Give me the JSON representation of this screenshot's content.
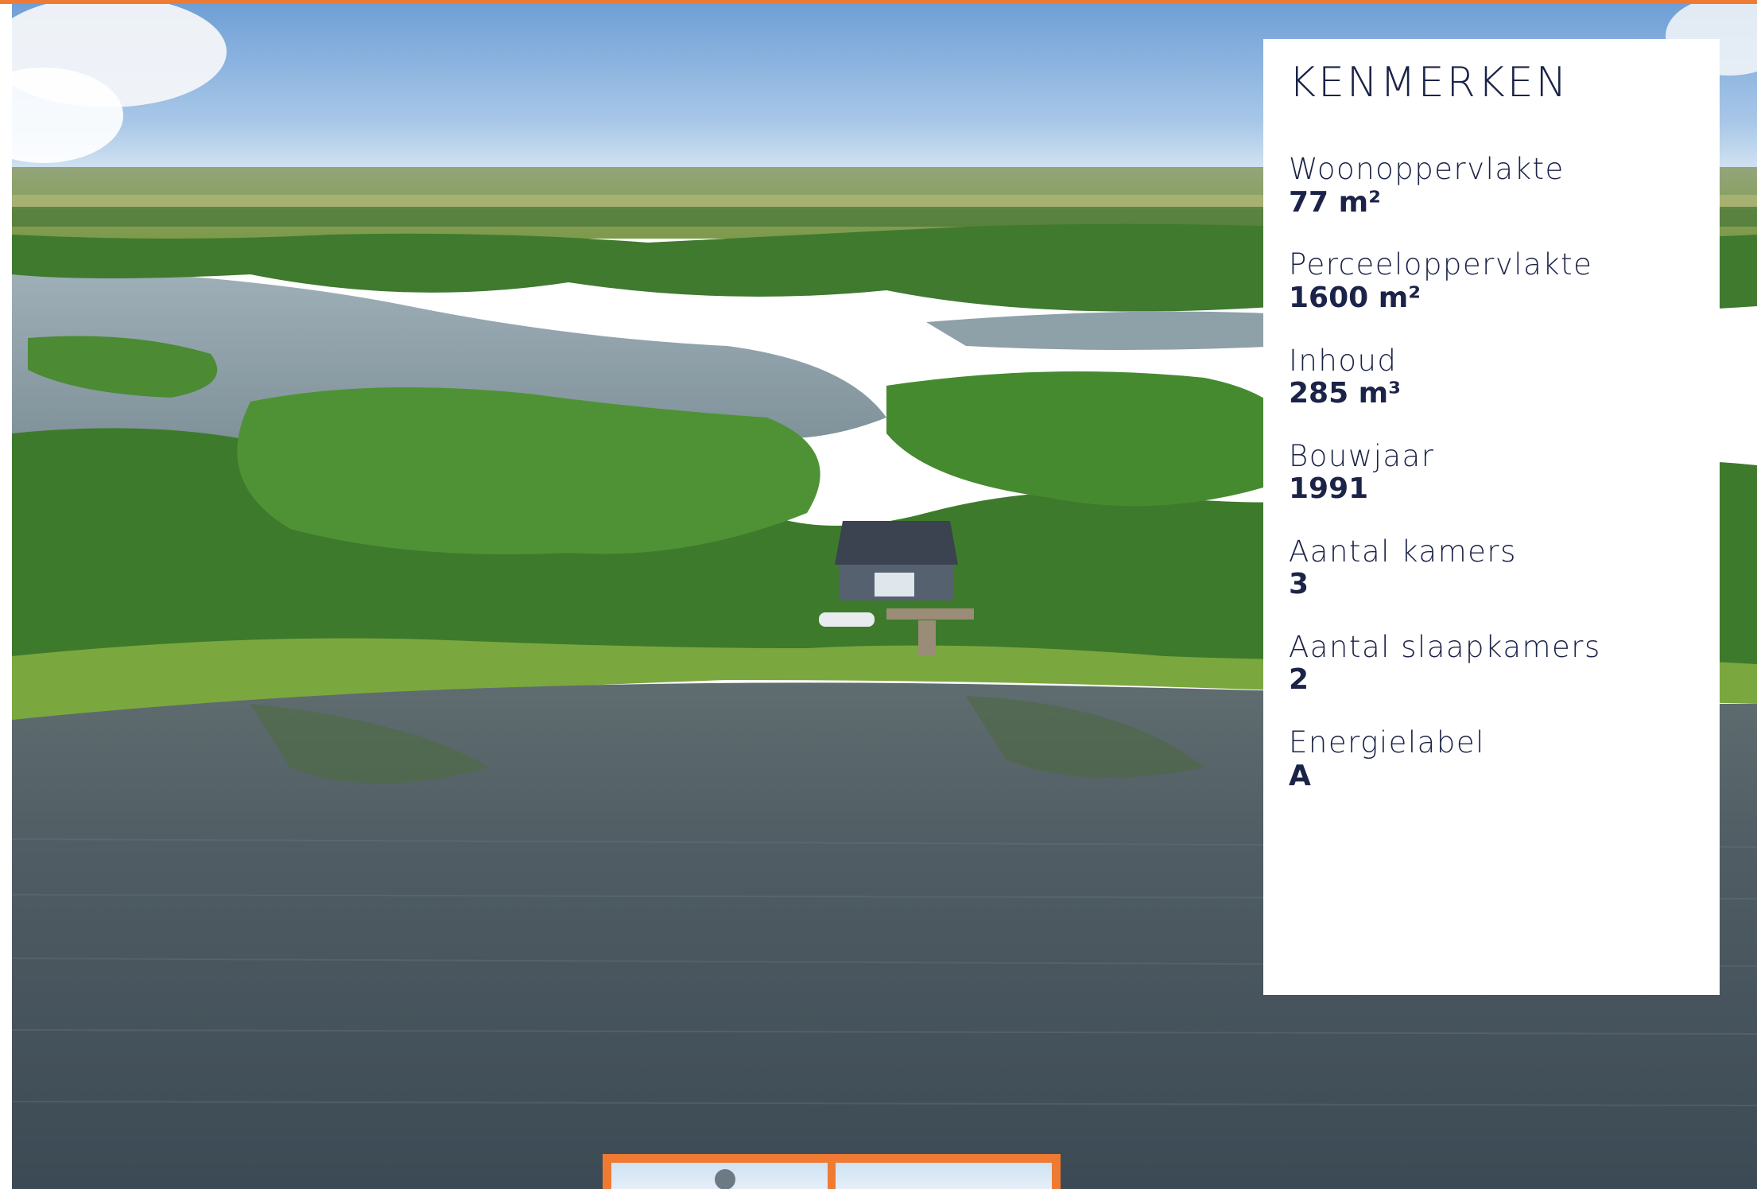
{
  "features": {
    "title": "KENMERKEN",
    "items": [
      {
        "label": "Woonoppervlakte",
        "value": "77 m²"
      },
      {
        "label": "Perceeloppervlakte",
        "value": "1600 m²"
      },
      {
        "label": "Inhoud",
        "value": "285 m³"
      },
      {
        "label": "Bouwjaar",
        "value": "1991"
      },
      {
        "label": "Aantal kamers",
        "value": "3"
      },
      {
        "label": "Aantal slaapkamers",
        "value": "2"
      },
      {
        "label": "Energielabel",
        "value": "A"
      }
    ]
  },
  "colors": {
    "accent": "#ef7a33",
    "text": "#1b2348"
  }
}
